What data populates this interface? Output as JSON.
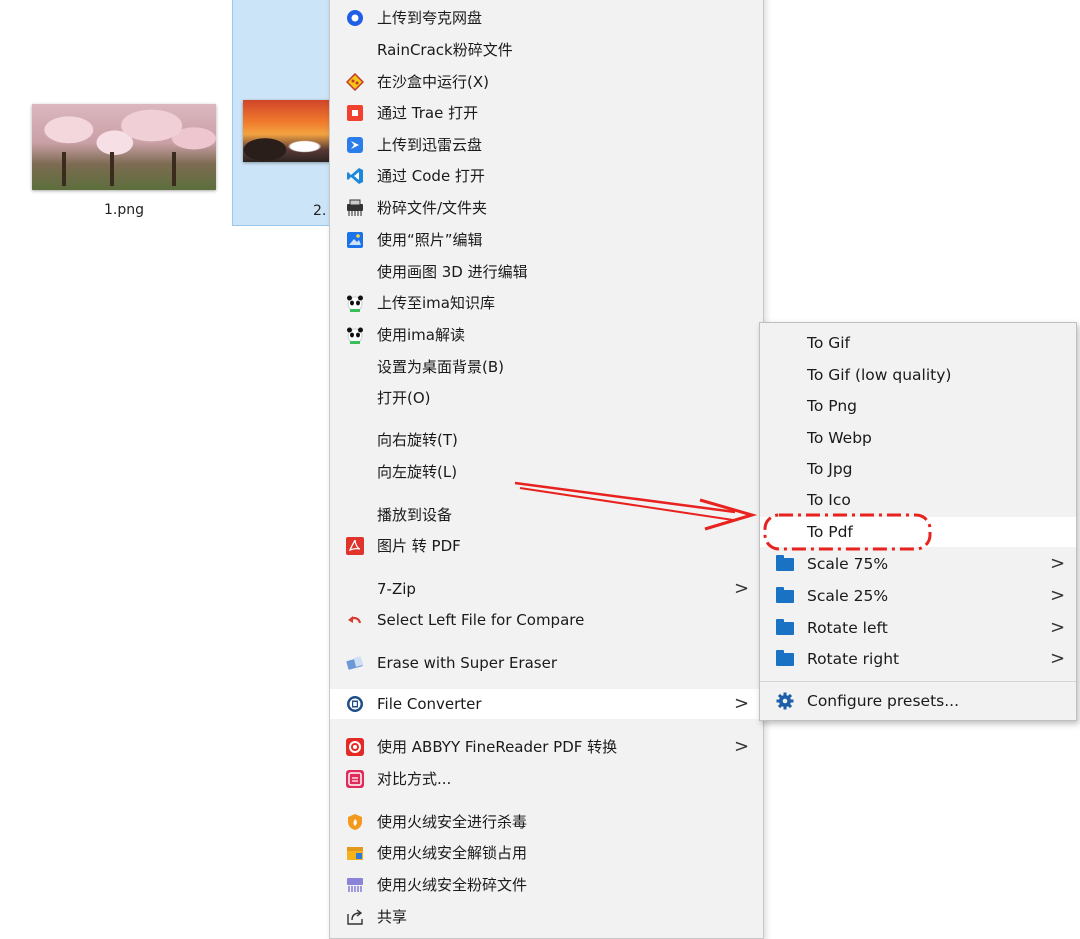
{
  "desktop": {
    "files": [
      {
        "label": "1.png"
      },
      {
        "label": "2."
      }
    ]
  },
  "context_menu": {
    "items": [
      {
        "label": "上传到夸克网盘",
        "icon": "quark-icon"
      },
      {
        "label": "RainCrack粉碎文件",
        "icon": ""
      },
      {
        "label": "在沙盒中运行(X)",
        "icon": "sandbox-icon"
      },
      {
        "label": "通过 Trae 打开",
        "icon": "trae-icon"
      },
      {
        "label": "上传到迅雷云盘",
        "icon": "thunder-icon"
      },
      {
        "label": "通过 Code 打开",
        "icon": "vscode-icon"
      },
      {
        "label": "粉碎文件/文件夹",
        "icon": "shredder-icon"
      },
      {
        "label": "使用“照片”编辑",
        "icon": "photos-icon"
      },
      {
        "label": "使用画图 3D 进行编辑",
        "icon": ""
      },
      {
        "label": "上传至ima知识库",
        "icon": "panda-icon"
      },
      {
        "label": "使用ima解读",
        "icon": "panda-icon"
      },
      {
        "label": "设置为桌面背景(B)",
        "icon": ""
      },
      {
        "label": "打开(O)",
        "icon": ""
      },
      {
        "label": "向右旋转(T)",
        "icon": ""
      },
      {
        "label": "向左旋转(L)",
        "icon": ""
      },
      {
        "label": "播放到设备",
        "icon": "",
        "submenu": true
      },
      {
        "label": "图片 转 PDF",
        "icon": "acrobat-icon"
      },
      {
        "label": "7-Zip",
        "icon": "",
        "submenu": true
      },
      {
        "label": "Select Left File for Compare",
        "icon": "compare-icon"
      },
      {
        "label": "Erase with Super Eraser",
        "icon": "eraser-icon"
      },
      {
        "label": "File Converter",
        "icon": "file-converter-icon",
        "submenu": true
      },
      {
        "label": "使用 ABBYY FineReader PDF 转换",
        "icon": "abbyy-icon",
        "submenu": true
      },
      {
        "label": "对比方式...",
        "icon": "compare-with-icon"
      },
      {
        "label": "使用火绒安全进行杀毒",
        "icon": "huorong-icon"
      },
      {
        "label": "使用火绒安全解锁占用",
        "icon": "unlock-icon"
      },
      {
        "label": "使用火绒安全粉碎文件",
        "icon": "shred-icon"
      },
      {
        "label": "共享",
        "icon": "share-icon"
      }
    ]
  },
  "submenu": {
    "items": [
      {
        "label": "To Gif"
      },
      {
        "label": "To Gif (low quality)"
      },
      {
        "label": "To Png"
      },
      {
        "label": "To Webp"
      },
      {
        "label": "To Jpg"
      },
      {
        "label": "To Ico"
      },
      {
        "label": "To Pdf"
      },
      {
        "label": "Scale 75%"
      },
      {
        "label": "Scale 25%"
      },
      {
        "label": "Rotate left"
      },
      {
        "label": "Rotate right"
      },
      {
        "label": "Configure presets..."
      }
    ]
  },
  "colors": {
    "selection": "#cce4f7",
    "menu_bg": "#f2f2f2",
    "highlight": "#ffffff",
    "folder": "#1a72c4",
    "annotation_red": "#e8231f"
  }
}
